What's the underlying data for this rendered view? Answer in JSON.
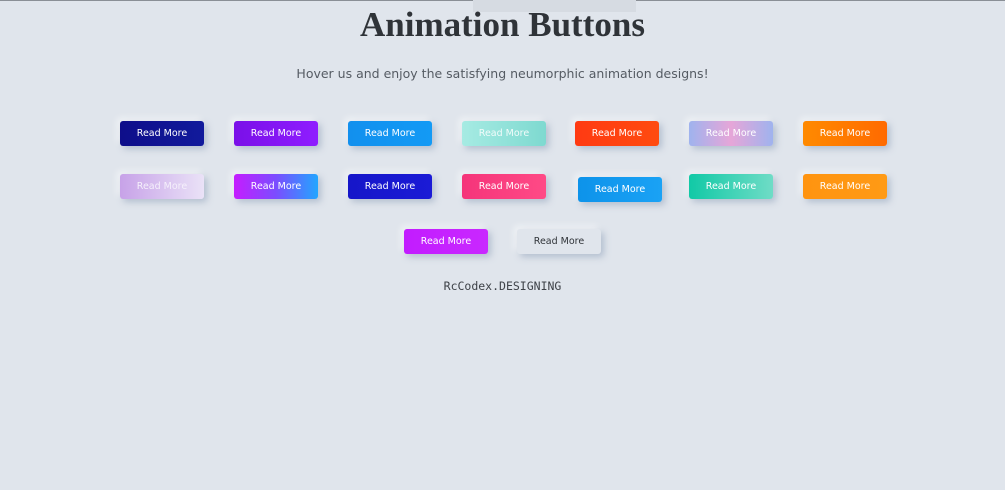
{
  "page": {
    "title": "Animation Buttons",
    "subtitle": "Hover us and enjoy the satisfying neumorphic animation designs!",
    "credit": "RcCodex.DESIGNING",
    "background_color": "#e0e5ec"
  },
  "buttons": [
    {
      "label": "Read More",
      "color": "#0e0e8a"
    },
    {
      "label": "Read More",
      "color": "#7a10e8"
    },
    {
      "label": "Read More",
      "color": "#1290ee"
    },
    {
      "label": "Read More",
      "color": "#a6ebe3"
    },
    {
      "label": "Read More",
      "color": "#ff3a12"
    },
    {
      "label": "Read More",
      "color": "#9fb3ee"
    },
    {
      "label": "Read More",
      "color": "#ff8a00"
    },
    {
      "label": "Read More",
      "color": "#c7a2e8"
    },
    {
      "label": "Read More",
      "color": "#c51cff"
    },
    {
      "label": "Read More",
      "color": "#1616c9"
    },
    {
      "label": "Read More",
      "color": "#f5347a"
    },
    {
      "label": "Read More",
      "color": "#0d93ea"
    },
    {
      "label": "Read More",
      "color": "#11c9a6"
    },
    {
      "label": "Read More",
      "color": "#ff9410"
    },
    {
      "label": "Read More",
      "color": "#c21cff"
    },
    {
      "label": "Read More",
      "color": "#e0e5ec"
    }
  ]
}
